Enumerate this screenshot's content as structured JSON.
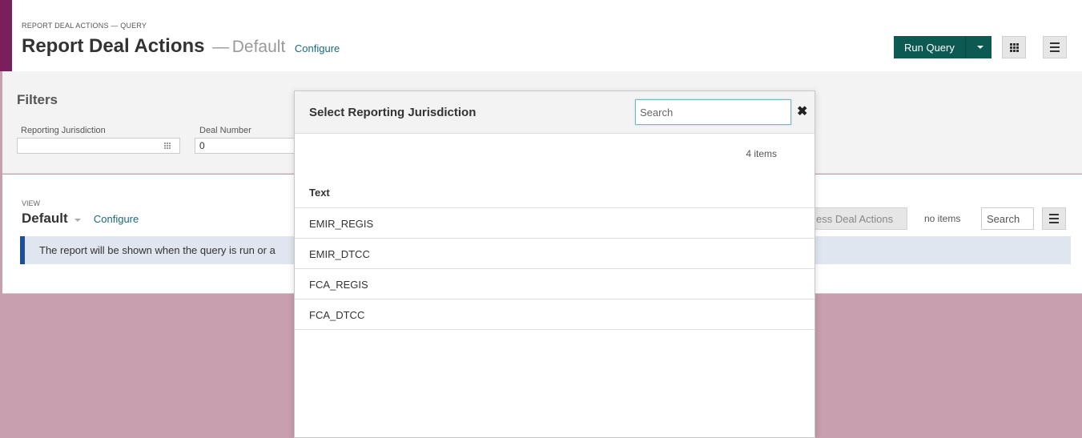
{
  "header": {
    "breadcrumb": "REPORT DEAL ACTIONS — QUERY",
    "title": "Report Deal Actions",
    "separator": "—",
    "view_name": "Default",
    "configure_label": "Configure",
    "run_query_label": "Run Query"
  },
  "filters": {
    "title": "Filters",
    "fields": [
      {
        "label": "Reporting Jurisdiction",
        "value": ""
      },
      {
        "label": "Deal Number",
        "value": "0"
      }
    ]
  },
  "view": {
    "label": "VIEW",
    "name": "Default",
    "configure_label": "Configure",
    "notice": "The report will be shown when the query is run or a",
    "process_button_label": "ess Deal Actions",
    "count": "no items",
    "search_placeholder": "Search"
  },
  "modal": {
    "title": "Select Reporting Jurisdiction",
    "search_placeholder": "Search",
    "count": "4 items",
    "column_header": "Text",
    "items": [
      "EMIR_REGIS",
      "EMIR_DTCC",
      "FCA_REGIS",
      "FCA_DTCC"
    ]
  },
  "colors": {
    "brand_bar": "#7a1f5c",
    "run_button": "#0d5a52",
    "page_background": "#c79fae",
    "notice_accent": "#1f4e9e",
    "link": "#1a6b7d"
  },
  "icons": {
    "grid": "grid-icon",
    "menu": "menu-icon",
    "close": "close-icon",
    "lookup": "lookup-icon",
    "caret": "chevron-down-icon"
  }
}
